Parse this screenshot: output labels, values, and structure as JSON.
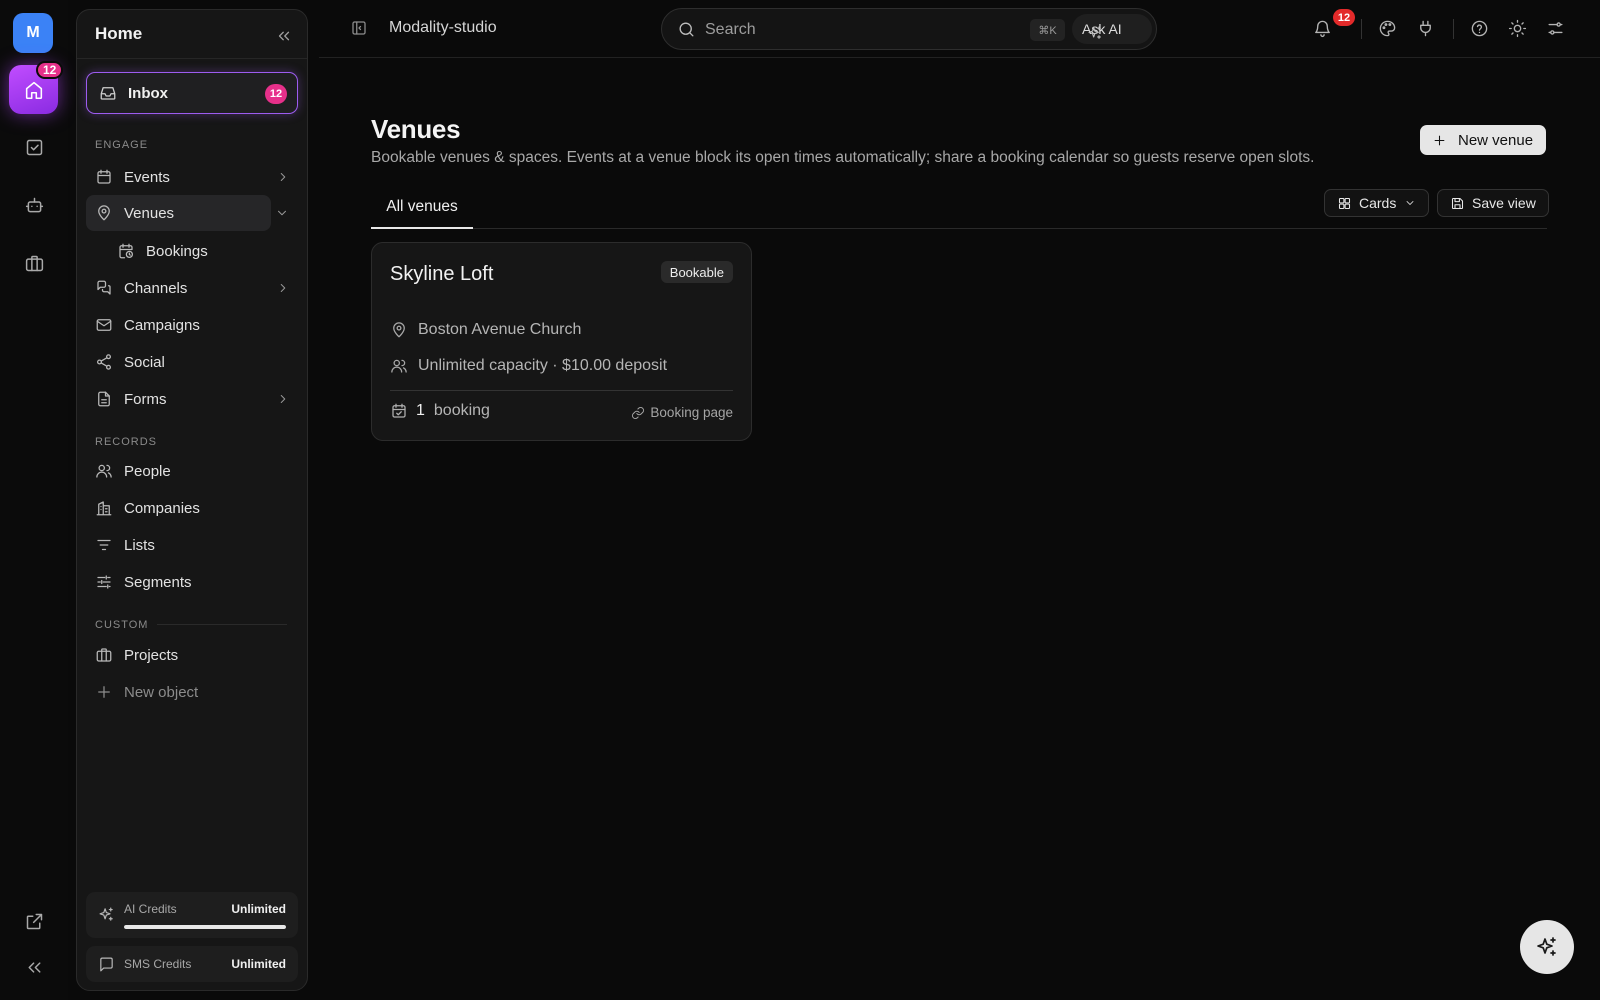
{
  "rail": {
    "avatar_initial": "M",
    "home_badge": "12",
    "icons": [
      "home-icon",
      "tasks-icon",
      "bot-icon",
      "briefcase-icon",
      "external-link-icon",
      "collapse-icon"
    ]
  },
  "sidebar": {
    "title": "Home",
    "inbox": {
      "label": "Inbox",
      "badge": "12"
    },
    "sections": {
      "engage": "ENGAGE",
      "records": "RECORDS",
      "custom": "CUSTOM"
    },
    "items": {
      "events": "Events",
      "venues": "Venues",
      "bookings": "Bookings",
      "channels": "Channels",
      "campaigns": "Campaigns",
      "social": "Social",
      "forms": "Forms",
      "people": "People",
      "companies": "Companies",
      "lists": "Lists",
      "segments": "Segments",
      "projects": "Projects",
      "new_object": "New object"
    },
    "credits": {
      "ai": {
        "label": "AI Credits",
        "value": "Unlimited",
        "fill_percent": 100
      },
      "sms": {
        "label": "SMS Credits",
        "value": "Unlimited"
      }
    }
  },
  "topbar": {
    "workspace": "Modality-studio",
    "search_placeholder": "Search",
    "shortcut": "⌘K",
    "ask_ai": "Ask AI",
    "notification_count": "12"
  },
  "main": {
    "title": "Venues",
    "description": "Bookable venues & spaces. Events at a venue block its open times automatically; share a booking calendar so guests reserve open slots.",
    "new_button": "New venue",
    "tab": "All venues",
    "view_mode": "Cards",
    "save_view": "Save view"
  },
  "venue_card": {
    "name": "Skyline Loft",
    "badge": "Bookable",
    "location": "Boston Avenue Church",
    "capacity": "Unlimited capacity · $10.00 deposit",
    "booking_count": "1",
    "booking_unit": "booking",
    "link": "Booking page"
  },
  "colors": {
    "accent_purple": "#9d5cf0",
    "badge_pink": "#e6308a",
    "notif_red": "#e32a2a",
    "avatar_blue": "#3b82f6"
  }
}
